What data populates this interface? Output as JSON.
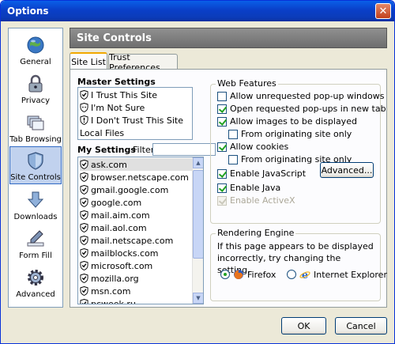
{
  "window": {
    "title": "Options",
    "close_glyph": "✕"
  },
  "sidebar": {
    "items": [
      {
        "label": "General",
        "icon": "globe-icon"
      },
      {
        "label": "Privacy",
        "icon": "lock-icon"
      },
      {
        "label": "Tab Browsing",
        "icon": "tabs-icon"
      },
      {
        "label": "Site Controls",
        "icon": "shield-icon",
        "selected": true
      },
      {
        "label": "Downloads",
        "icon": "download-arrow-icon"
      },
      {
        "label": "Form Fill",
        "icon": "pen-icon"
      },
      {
        "label": "Advanced",
        "icon": "gear-icon"
      }
    ]
  },
  "header": {
    "title": "Site Controls"
  },
  "tabs": [
    {
      "label": "Site List",
      "active": true
    },
    {
      "label": "Trust Preferences",
      "active": false
    }
  ],
  "master_settings": {
    "label": "Master Settings",
    "items": [
      "I Trust This Site",
      "I'm Not Sure",
      "I Don't Trust This Site",
      "Local Files"
    ]
  },
  "my_settings": {
    "label": "My Settings",
    "filter_label": "Filter",
    "filter_value": "",
    "sites": [
      "ask.com",
      "browser.netscape.com",
      "gmail.google.com",
      "google.com",
      "mail.aim.com",
      "mail.aol.com",
      "mail.netscape.com",
      "mailblocks.com",
      "microsoft.com",
      "mozilla.org",
      "msn.com",
      "pcweek.ru"
    ],
    "selected_site": "ask.com"
  },
  "web_features": {
    "label": "Web Features",
    "options": [
      {
        "label": "Allow unrequested pop-up windows",
        "checked": false,
        "indent": false,
        "disabled": false
      },
      {
        "label": "Open requested pop-ups in new tab",
        "checked": true,
        "indent": false,
        "disabled": false
      },
      {
        "label": "Allow images to be displayed",
        "checked": true,
        "indent": false,
        "disabled": false
      },
      {
        "label": "From originating site only",
        "checked": false,
        "indent": true,
        "disabled": false
      },
      {
        "label": "Allow cookies",
        "checked": true,
        "indent": false,
        "disabled": false
      },
      {
        "label": "From originating site only",
        "checked": false,
        "indent": true,
        "disabled": false
      },
      {
        "label": "Enable JavaScript",
        "checked": true,
        "indent": false,
        "disabled": false
      },
      {
        "label": "Enable Java",
        "checked": true,
        "indent": false,
        "disabled": false
      },
      {
        "label": "Enable ActiveX",
        "checked": true,
        "indent": false,
        "disabled": true
      }
    ],
    "advanced_label": "Advanced..."
  },
  "rendering_engine": {
    "label": "Rendering Engine",
    "description": "If this page appears to be displayed incorrectly, try changing the setting.",
    "options": [
      {
        "label": "Firefox",
        "selected": true,
        "icon": "firefox-icon"
      },
      {
        "label": "Internet Explorer",
        "selected": false,
        "icon": "ie-icon"
      }
    ]
  },
  "footer": {
    "ok_label": "OK",
    "cancel_label": "Cancel"
  },
  "colors": {
    "title_bar": "#0a3fc8",
    "accent": "#316ac5",
    "check": "#21a121"
  }
}
